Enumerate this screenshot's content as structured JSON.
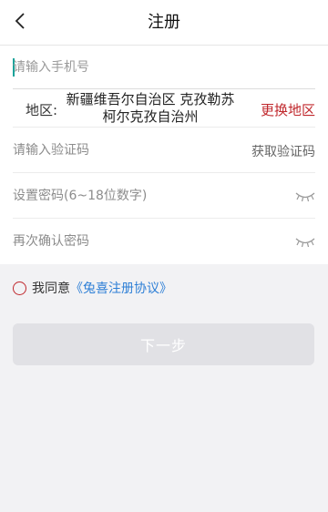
{
  "header": {
    "back_icon": "chevron-left-icon",
    "title": "注册"
  },
  "form": {
    "phone": {
      "placeholder": "请输入手机号",
      "value": ""
    },
    "region": {
      "label": "地区:",
      "value": "新疆维吾尔自治区 克孜勒苏柯尔克孜自治州",
      "change_label": "更换地区",
      "change_color": "#c0282d"
    },
    "code": {
      "placeholder": "请输入验证码",
      "value": "",
      "get_code_label": "获取验证码"
    },
    "password": {
      "placeholder": "设置密码(6~18位数字)",
      "value": "",
      "eye_icon": "eye-closed-icon"
    },
    "confirm": {
      "placeholder": "再次确认密码",
      "value": "",
      "eye_icon": "eye-closed-icon"
    }
  },
  "agreement": {
    "prefix": "我同意",
    "link": "《兔喜注册协议》",
    "link_color": "#2d7fd6",
    "checked": false
  },
  "next_button": {
    "label": "下一步",
    "enabled": false
  }
}
